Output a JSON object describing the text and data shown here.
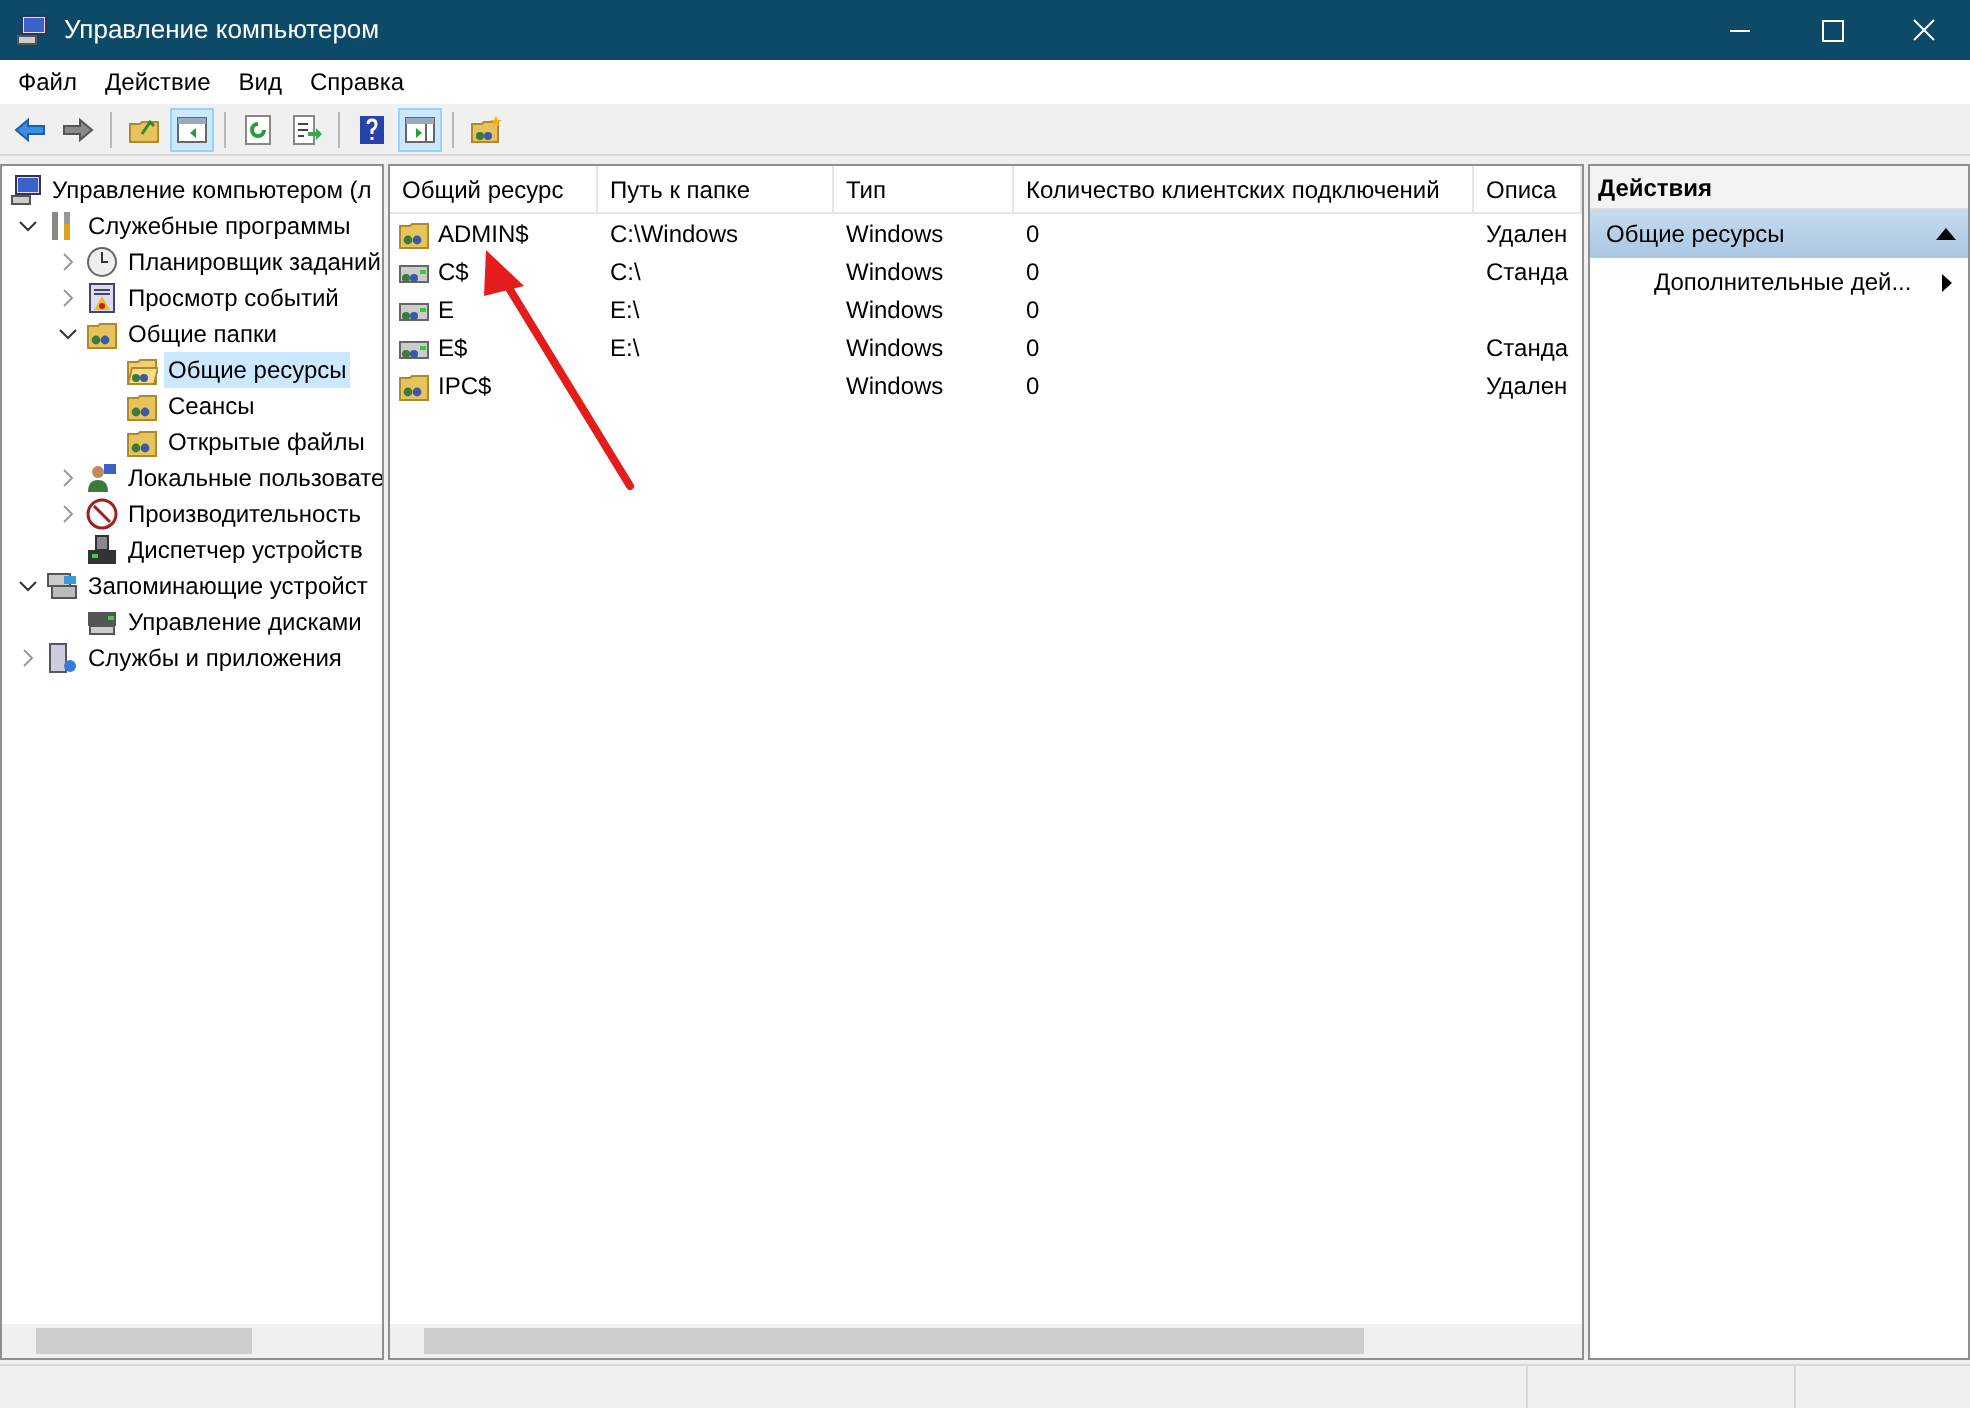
{
  "window": {
    "title": "Управление компьютером"
  },
  "menu": [
    "Файл",
    "Действие",
    "Вид",
    "Справка"
  ],
  "toolbar": [
    {
      "kind": "back",
      "pressed": false
    },
    {
      "kind": "forward",
      "pressed": false
    },
    {
      "kind": "sep"
    },
    {
      "kind": "up",
      "pressed": false
    },
    {
      "kind": "tree",
      "pressed": true
    },
    {
      "kind": "sep"
    },
    {
      "kind": "refresh",
      "pressed": false
    },
    {
      "kind": "export",
      "pressed": false
    },
    {
      "kind": "sep"
    },
    {
      "kind": "help",
      "pressed": false
    },
    {
      "kind": "actionpane",
      "pressed": true
    },
    {
      "kind": "sep"
    },
    {
      "kind": "newshare",
      "pressed": false
    }
  ],
  "tree": [
    {
      "label": "Управление компьютером (л",
      "kind": "computer",
      "selected": false,
      "children": [
        {
          "label": "Служебные программы",
          "kind": "tools",
          "expanded": true,
          "selected": false,
          "children": [
            {
              "label": "Планировщик заданий",
              "kind": "clock",
              "expanded": false,
              "selected": false
            },
            {
              "label": "Просмотр событий",
              "kind": "event",
              "expanded": false,
              "selected": false
            },
            {
              "label": "Общие папки",
              "kind": "share",
              "expanded": true,
              "selected": false,
              "children": [
                {
                  "label": "Общие ресурсы",
                  "kind": "openshare",
                  "selected": true
                },
                {
                  "label": "Сеансы",
                  "kind": "share",
                  "selected": false
                },
                {
                  "label": "Открытые файлы",
                  "kind": "share",
                  "selected": false
                }
              ]
            },
            {
              "label": "Локальные пользовате",
              "kind": "users",
              "expanded": false,
              "selected": false
            },
            {
              "label": "Производительность",
              "kind": "perf",
              "expanded": false,
              "selected": false
            },
            {
              "label": "Диспетчер устройств",
              "kind": "device",
              "selected": false
            }
          ]
        },
        {
          "label": "Запоминающие устройст",
          "kind": "storage",
          "expanded": true,
          "selected": false,
          "children": [
            {
              "label": "Управление дисками",
              "kind": "disk",
              "selected": false
            }
          ]
        },
        {
          "label": "Службы и приложения",
          "kind": "services",
          "expanded": false,
          "selected": false
        }
      ]
    }
  ],
  "table": {
    "columns": [
      "Общий ресурс",
      "Путь к папке",
      "Тип",
      "Количество клиентских подключений",
      "Описа"
    ],
    "rows": [
      {
        "kind": "share",
        "cells": [
          "ADMIN$",
          "C:\\Windows",
          "Windows",
          "0",
          "Удален"
        ]
      },
      {
        "kind": "drive",
        "cells": [
          "C$",
          "C:\\",
          "Windows",
          "0",
          "Станда"
        ]
      },
      {
        "kind": "drive",
        "cells": [
          "E",
          "E:\\",
          "Windows",
          "0"
        ]
      },
      {
        "kind": "drive",
        "cells": [
          "E$",
          "E:\\",
          "Windows",
          "0",
          "Станда"
        ]
      },
      {
        "kind": "share",
        "cells": [
          "IPC$",
          "",
          "Windows",
          "0",
          "Удален"
        ]
      }
    ]
  },
  "actions": {
    "title": "Действия",
    "section": "Общие ресурсы",
    "items": [
      "Дополнительные дей..."
    ]
  }
}
